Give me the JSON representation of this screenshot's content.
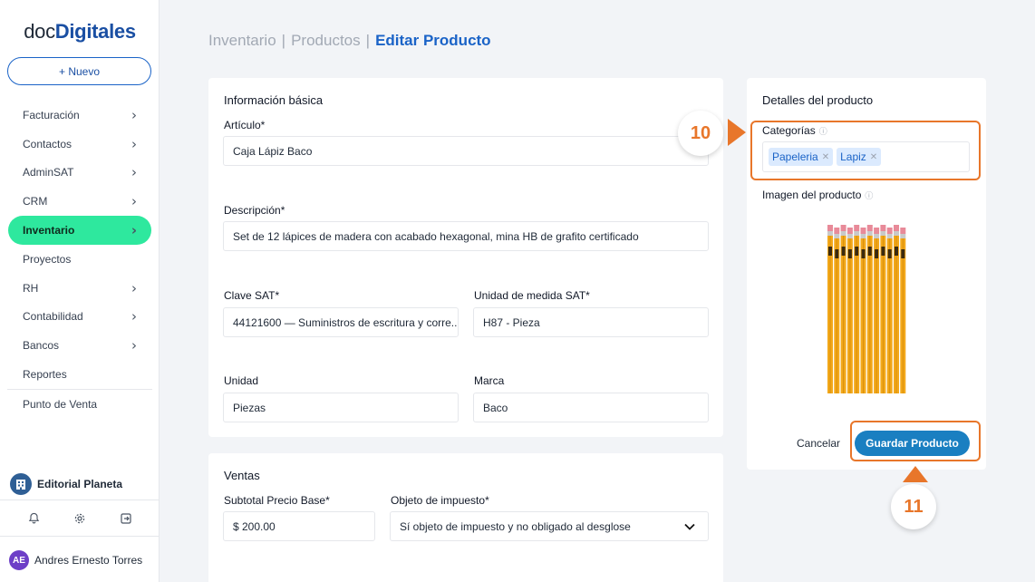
{
  "app": {
    "logo_left": "doc",
    "logo_right": "Digitales"
  },
  "sidebar": {
    "new_button": "+ Nuevo",
    "items": [
      {
        "label": "Facturación",
        "chevron": true
      },
      {
        "label": "Contactos",
        "chevron": true
      },
      {
        "label": "AdminSAT",
        "chevron": true
      },
      {
        "label": "CRM",
        "chevron": true
      },
      {
        "label": "Inventario",
        "chevron": true,
        "active": true
      },
      {
        "label": "Proyectos",
        "chevron": false
      },
      {
        "label": "RH",
        "chevron": true
      },
      {
        "label": "Contabilidad",
        "chevron": true
      },
      {
        "label": "Bancos",
        "chevron": true
      },
      {
        "label": "Reportes",
        "chevron": false
      },
      {
        "label": "Punto de Venta",
        "chevron": false
      }
    ],
    "company": "Editorial Planeta",
    "user_initials": "AE",
    "user_name": "Andres Ernesto Torres"
  },
  "breadcrumb": {
    "first": "Inventario",
    "second": "Productos",
    "current": "Editar Producto",
    "separator": "|"
  },
  "basic_info": {
    "title": "Información básica",
    "articulo_label": "Artículo*",
    "articulo_value": "Caja Lápiz Baco",
    "descripcion_label": "Descripción*",
    "descripcion_value": "Set de 12 lápices de madera con acabado hexagonal, mina HB de grafito certificado",
    "clave_sat_label": "Clave SAT*",
    "clave_sat_value": "44121600 — Suministros de escritura y corre...",
    "unidad_sat_label": "Unidad de medida SAT*",
    "unidad_sat_value": "H87 - Pieza",
    "unidad_label": "Unidad",
    "unidad_value": "Piezas",
    "marca_label": "Marca",
    "marca_value": "Baco"
  },
  "ventas": {
    "title": "Ventas",
    "subtotal_label": "Subtotal Precio Base*",
    "subtotal_value": "$  200.00",
    "objeto_label": "Objeto de impuesto*",
    "objeto_value": "Sí objeto de impuesto y no obligado al desglose"
  },
  "details": {
    "title": "Detalles del producto",
    "categorias_label": "Categorías",
    "tags": [
      "Papeleria",
      "Lapiz"
    ],
    "imagen_label": "Imagen del producto",
    "cancel_label": "Cancelar",
    "save_label": "Guardar Producto"
  },
  "annotations": {
    "step_10": "10",
    "step_11": "11"
  },
  "colors": {
    "accent": "#1a63c7",
    "active_nav": "#2ee89e",
    "highlight": "#e8762a",
    "save_button": "#1a7fc1"
  }
}
